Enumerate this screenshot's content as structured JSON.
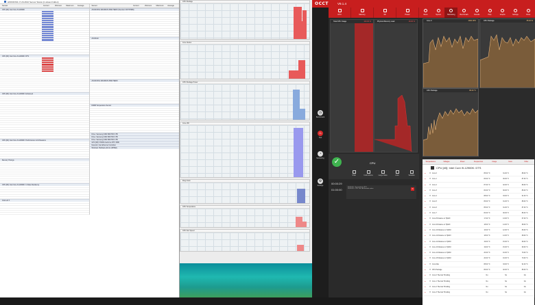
{
  "hwinfo": {
    "title": "HWiNFO64 v7.20-4610 Sensor Status [1 values hidden]",
    "columns": [
      "Sensor",
      "Current",
      "Minimum",
      "Maximum",
      "Average"
    ],
    "sections": [
      {
        "title": "CPU [#0]: Intel Core i9-12900K",
        "rows": 20
      },
      {
        "title": "CPU [#0]: Intel Core i9-12900K: DTS",
        "rows": 16
      },
      {
        "title": "CPU [#0]: Intel Core i9-12900K: Enhanced",
        "rows": 20
      },
      {
        "title": "CPU [#0]: Intel Core i9-12900K: Performance Limit Reasons",
        "rows": 8
      },
      {
        "title": "Memory Timings",
        "rows": 10
      },
      {
        "title": "CPU [#0]: Intel Core i9-12900K: C-State Residency",
        "rows": 6
      },
      {
        "title": "S.M.A.R.T.",
        "rows": 6
      }
    ],
    "right_sections": [
      {
        "title": "ASUS ROG MAXIMUS Z690 HERO (Nuvoton NCT6798D)",
        "rows": 12
      },
      {
        "title": "ASUS EC",
        "rows": 18
      },
      {
        "title": "ASUS ROG MAXIMUS Z690 HERO",
        "rows": 10
      },
      {
        "title": "DIMM Temperature Sensor",
        "rows": 12
      },
      {
        "title": "Drive: Samsung SSD 980 PRO 1TB",
        "rows": 0
      },
      {
        "title": "Drive: Samsung SSD 980 PRO 1TB",
        "rows": 0
      },
      {
        "title": "Drive: Samsung SSD 980 PRO 1TB",
        "rows": 0
      },
      {
        "title": "GPU [#0]: NVIDIA GeForce RTX 3080",
        "rows": 0
      },
      {
        "title": "Network: Intel Ethernet Controller",
        "rows": 0
      },
      {
        "title": "Windows Hardware Errors (WHEA)",
        "rows": 0
      }
    ]
  },
  "graphs": [
    {
      "title": "CPU Package",
      "color": "#e85a5a"
    },
    {
      "title": "Core Clocks",
      "color": "#e85a5a"
    },
    {
      "title": "CPU Package Power",
      "color": "#88aadd"
    },
    {
      "title": "Core VID",
      "color": "#9999ee"
    },
    {
      "title": "Ring Clock",
      "color": "#7788cc"
    },
    {
      "title": "CPU Temperature",
      "color": "#e88"
    },
    {
      "title": "CPU Fan Speed",
      "color": "#e88"
    }
  ],
  "occt": {
    "logo": "OCCT",
    "version": "V9.1.4",
    "left_nav": [
      {
        "label": "Benchmark",
        "icon": "timer-icon"
      },
      {
        "label": "Test",
        "icon": "flame-icon"
      },
      {
        "label": "Monitoring",
        "icon": "gauge-icon"
      },
      {
        "label": "Settings",
        "icon": "wrench-icon"
      }
    ],
    "test_tabs": [
      "CPU",
      "Memory",
      "3D",
      "Power"
    ],
    "main_charts": [
      {
        "title": "Total CPU Usage",
        "value": "100.00 %"
      },
      {
        "title": "Physical Memory Load",
        "value": "26.00 %"
      },
      {
        "title": "CPU Package",
        "value": "86.00 °C"
      }
    ],
    "status": {
      "test_name": "CPU",
      "icons": [
        "SSE",
        "Instructions",
        "Large Data",
        "Auto",
        "Variable"
      ],
      "elapsed": "00:00:29",
      "duration": "01:00:00",
      "log_lines": [
        "00:00:00 - Test started: CPU",
        "00:00:00 - CPU Test: All threads active"
      ]
    },
    "right_tabs": [
      "Menu",
      "System",
      "Monitoring",
      "Benchmark",
      "Results",
      "Help",
      "Graphs",
      "Settings",
      "Close"
    ],
    "right_charts": [
      {
        "title": "Core 0",
        "value": "4900 MHz"
      },
      {
        "title": "CPU Package",
        "value": "85.00 W"
      },
      {
        "title": "CPU Package",
        "value": "86.00 °C"
      }
    ],
    "table": {
      "title": "CPU [#0]: Intel Core i9-12900K: DTS",
      "tabs": [
        "Temperatures",
        "Voltages",
        "Power",
        "Frequencies",
        "Usage",
        "Fans",
        "Other"
      ],
      "rows": [
        {
          "name": "Core 0",
          "val": "85.00 °C",
          "min": "31.00 °C",
          "max": "88.00 °C"
        },
        {
          "name": "Core 1",
          "val": "83.00 °C",
          "min": "30.00 °C",
          "max": "87.00 °C"
        },
        {
          "name": "Core 2",
          "val": "87.00 °C",
          "min": "32.00 °C",
          "max": "89.00 °C"
        },
        {
          "name": "Core 3",
          "val": "84.00 °C",
          "min": "30.00 °C",
          "max": "86.00 °C"
        },
        {
          "name": "Core 4",
          "val": "88.00 °C",
          "min": "33.00 °C",
          "max": "91.00 °C"
        },
        {
          "name": "Core 5",
          "val": "86.00 °C",
          "min": "31.00 °C",
          "max": "88.00 °C"
        },
        {
          "name": "Core 6",
          "val": "85.00 °C",
          "min": "31.00 °C",
          "max": "87.00 °C"
        },
        {
          "name": "Core 7",
          "val": "84.00 °C",
          "min": "30.00 °C",
          "max": "86.00 °C"
        },
        {
          "name": "Core 8 Distance to TjMAX",
          "val": "17.00 °C",
          "min": "13.00 °C",
          "max": "67.00 °C"
        },
        {
          "name": "Core 9 Distance to TjMAX",
          "val": "18.00 °C",
          "min": "14.00 °C",
          "max": "68.00 °C"
        },
        {
          "name": "Core 10 Distance to TjMAX",
          "val": "16.00 °C",
          "min": "12.00 °C",
          "max": "66.00 °C"
        },
        {
          "name": "Core 11 Distance to TjMAX",
          "val": "18.00 °C",
          "min": "14.00 °C",
          "max": "68.00 °C"
        },
        {
          "name": "Core 12 Distance to TjMAX",
          "val": "19.00 °C",
          "min": "15.00 °C",
          "max": "69.00 °C"
        },
        {
          "name": "Core 13 Distance to TjMAX",
          "val": "19.00 °C",
          "min": "15.00 °C",
          "max": "69.00 °C"
        },
        {
          "name": "Core 14 Distance to TjMAX",
          "val": "20.00 °C",
          "min": "16.00 °C",
          "max": "70.00 °C"
        },
        {
          "name": "Core 15 Distance to TjMAX",
          "val": "20.00 °C",
          "min": "16.00 °C",
          "max": "70.00 °C"
        },
        {
          "name": "Core Max",
          "val": "88.00 °C",
          "min": "33.00 °C",
          "max": "91.00 °C"
        },
        {
          "name": "CPU Package",
          "val": "86.00 °C",
          "min": "32.00 °C",
          "max": "89.00 °C"
        },
        {
          "name": "Core 0 Thermal Throttling",
          "val": "No",
          "min": "No",
          "max": "No"
        },
        {
          "name": "Core 1 Thermal Throttling",
          "val": "No",
          "min": "No",
          "max": "No"
        },
        {
          "name": "Core 2 Thermal Throttling",
          "val": "No",
          "min": "No",
          "max": "No"
        },
        {
          "name": "Core 3 Thermal Throttling",
          "val": "No",
          "min": "No",
          "max": "No"
        }
      ]
    }
  }
}
